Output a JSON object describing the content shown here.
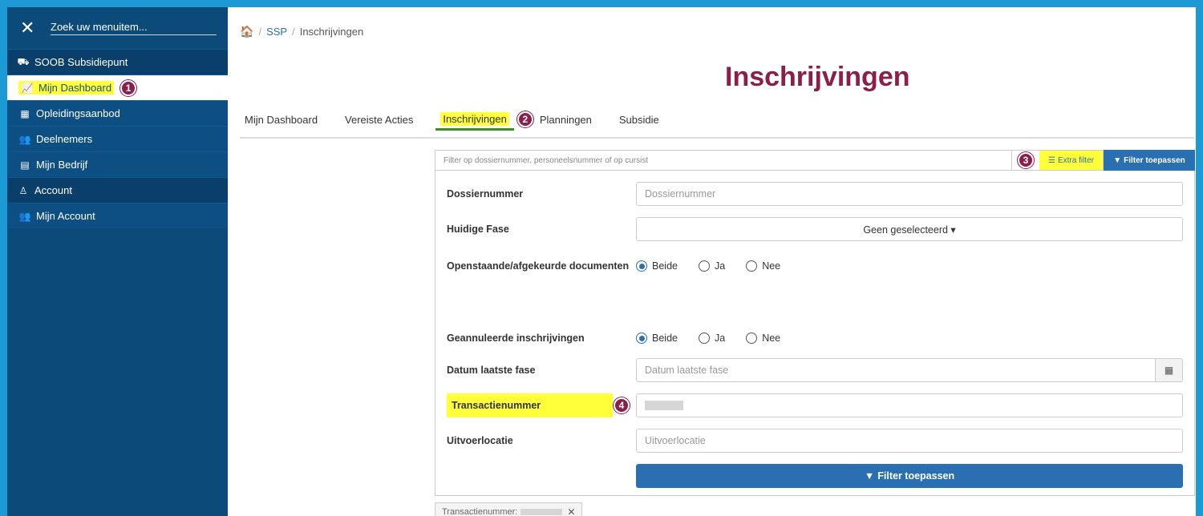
{
  "sidebar": {
    "close_icon": "close-icon",
    "search_placeholder": "Zoek uw menuitem...",
    "sections": [
      {
        "label": "SOOB Subsidiepunt",
        "icon": "truck-icon",
        "icon_glyph": "⛟"
      },
      {
        "label": "Account",
        "icon": "user-icon",
        "icon_glyph": "♙"
      }
    ],
    "items": [
      {
        "label": "Mijn Dashboard",
        "icon_glyph": "📈",
        "active": true,
        "badge": "1"
      },
      {
        "label": "Opleidingsaanbod",
        "icon_glyph": "▦"
      },
      {
        "label": "Deelnemers",
        "icon_glyph": "👥"
      },
      {
        "label": "Mijn Bedrijf",
        "icon_glyph": "▤"
      },
      {
        "label": "Mijn Account",
        "icon_glyph": "👥"
      }
    ]
  },
  "breadcrumb": {
    "home_glyph": "🏠",
    "sep": "/",
    "link": "SSP",
    "current": "Inschrijvingen"
  },
  "page_title": "Inschrijvingen",
  "tabs": [
    {
      "label": "Mijn Dashboard"
    },
    {
      "label": "Vereiste Acties"
    },
    {
      "label": "Inschrijvingen",
      "active": true,
      "badge": "2"
    },
    {
      "label": "Planningen"
    },
    {
      "label": "Subsidie"
    }
  ],
  "filter": {
    "placeholder": "Filter op dossiernummer, personeelsnummer of op cursist",
    "badge": "3",
    "extra_label": "Extra filter",
    "apply_label": "Filter toepassen"
  },
  "fields": {
    "dossier": {
      "label": "Dossiernummer",
      "placeholder": "Dossiernummer"
    },
    "fase": {
      "label": "Huidige Fase",
      "value": "Geen geselecteerd ▾"
    },
    "docs": {
      "label": "Openstaande/afgekeurde documenten",
      "options": [
        "Beide",
        "Ja",
        "Nee"
      ],
      "selected": "Beide"
    },
    "geannuleerd": {
      "label": "Geannuleerde inschrijvingen",
      "options": [
        "Beide",
        "Ja",
        "Nee"
      ],
      "selected": "Beide"
    },
    "datum": {
      "label": "Datum laatste fase",
      "placeholder": "Datum laatste fase"
    },
    "transactie": {
      "label": "Transactienummer",
      "badge": "4"
    },
    "locatie": {
      "label": "Uitvoerlocatie",
      "placeholder": "Uitvoerlocatie"
    }
  },
  "apply_button": "Filter toepassen",
  "chip": {
    "label": "Transactienummer:",
    "remove": "✕"
  },
  "colors": {
    "accent": "#2a6fb1",
    "title": "#8b1e4a",
    "sidebar": "#0c4a7a",
    "highlight": "#ffff3a",
    "frame": "#1b9ad6"
  }
}
